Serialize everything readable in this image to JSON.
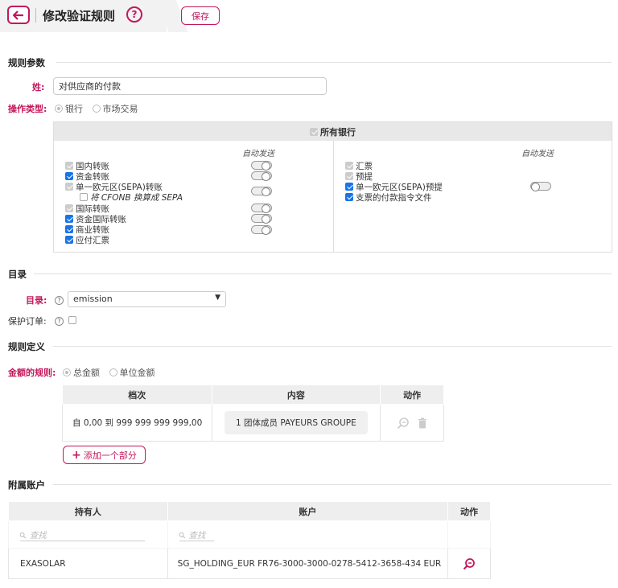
{
  "header": {
    "title": "修改验证规则",
    "help": "?",
    "save_label": "保存"
  },
  "params": {
    "section": "规则参数",
    "name_label": "姓:",
    "name_value": "对供应商的付款",
    "optype_label": "操作类型:",
    "optype_options": [
      "银行",
      "市场交易"
    ]
  },
  "banks": {
    "header": "所有银行",
    "auto_label_left": "自动发送",
    "auto_label_right": "自动发送",
    "left": [
      "国内转账",
      "资金转账",
      "单一欧元区(SEPA)转账",
      "将 CFONB 换算成 SEPA",
      "国际转账",
      "资金国际转账",
      "商业转账",
      "应付汇票"
    ],
    "right": [
      "汇票",
      "预提",
      "单一欧元区(SEPA)预提",
      "支票的付款指令文件"
    ]
  },
  "catalog": {
    "section": "目录",
    "dir_label": "目录:",
    "dir_value": "emission",
    "protect_label": "保护订单:"
  },
  "ruledef": {
    "section": "规则定义",
    "amount_label": "金额的规则:",
    "amount_options": [
      "总金额",
      "单位金额"
    ],
    "columns": [
      "档次",
      "内容",
      "动作"
    ],
    "rows": [
      {
        "range": "自 0,00 到 999 999 999 999,00",
        "content": "1 团体成员 PAYEURS GROUPE"
      }
    ],
    "add_label": "添加一个部分"
  },
  "accounts": {
    "section": "附属账户",
    "columns": [
      "持有人",
      "账户",
      "动作"
    ],
    "search_placeholder": "查找",
    "rows": [
      {
        "holder": "EXASOLAR",
        "account": "SG_HOLDING_EUR FR76-3000-3000-0278-5412-3658-434 EUR"
      }
    ]
  },
  "colors": {
    "accent": "#c2185b",
    "check": "#1a73e8"
  }
}
